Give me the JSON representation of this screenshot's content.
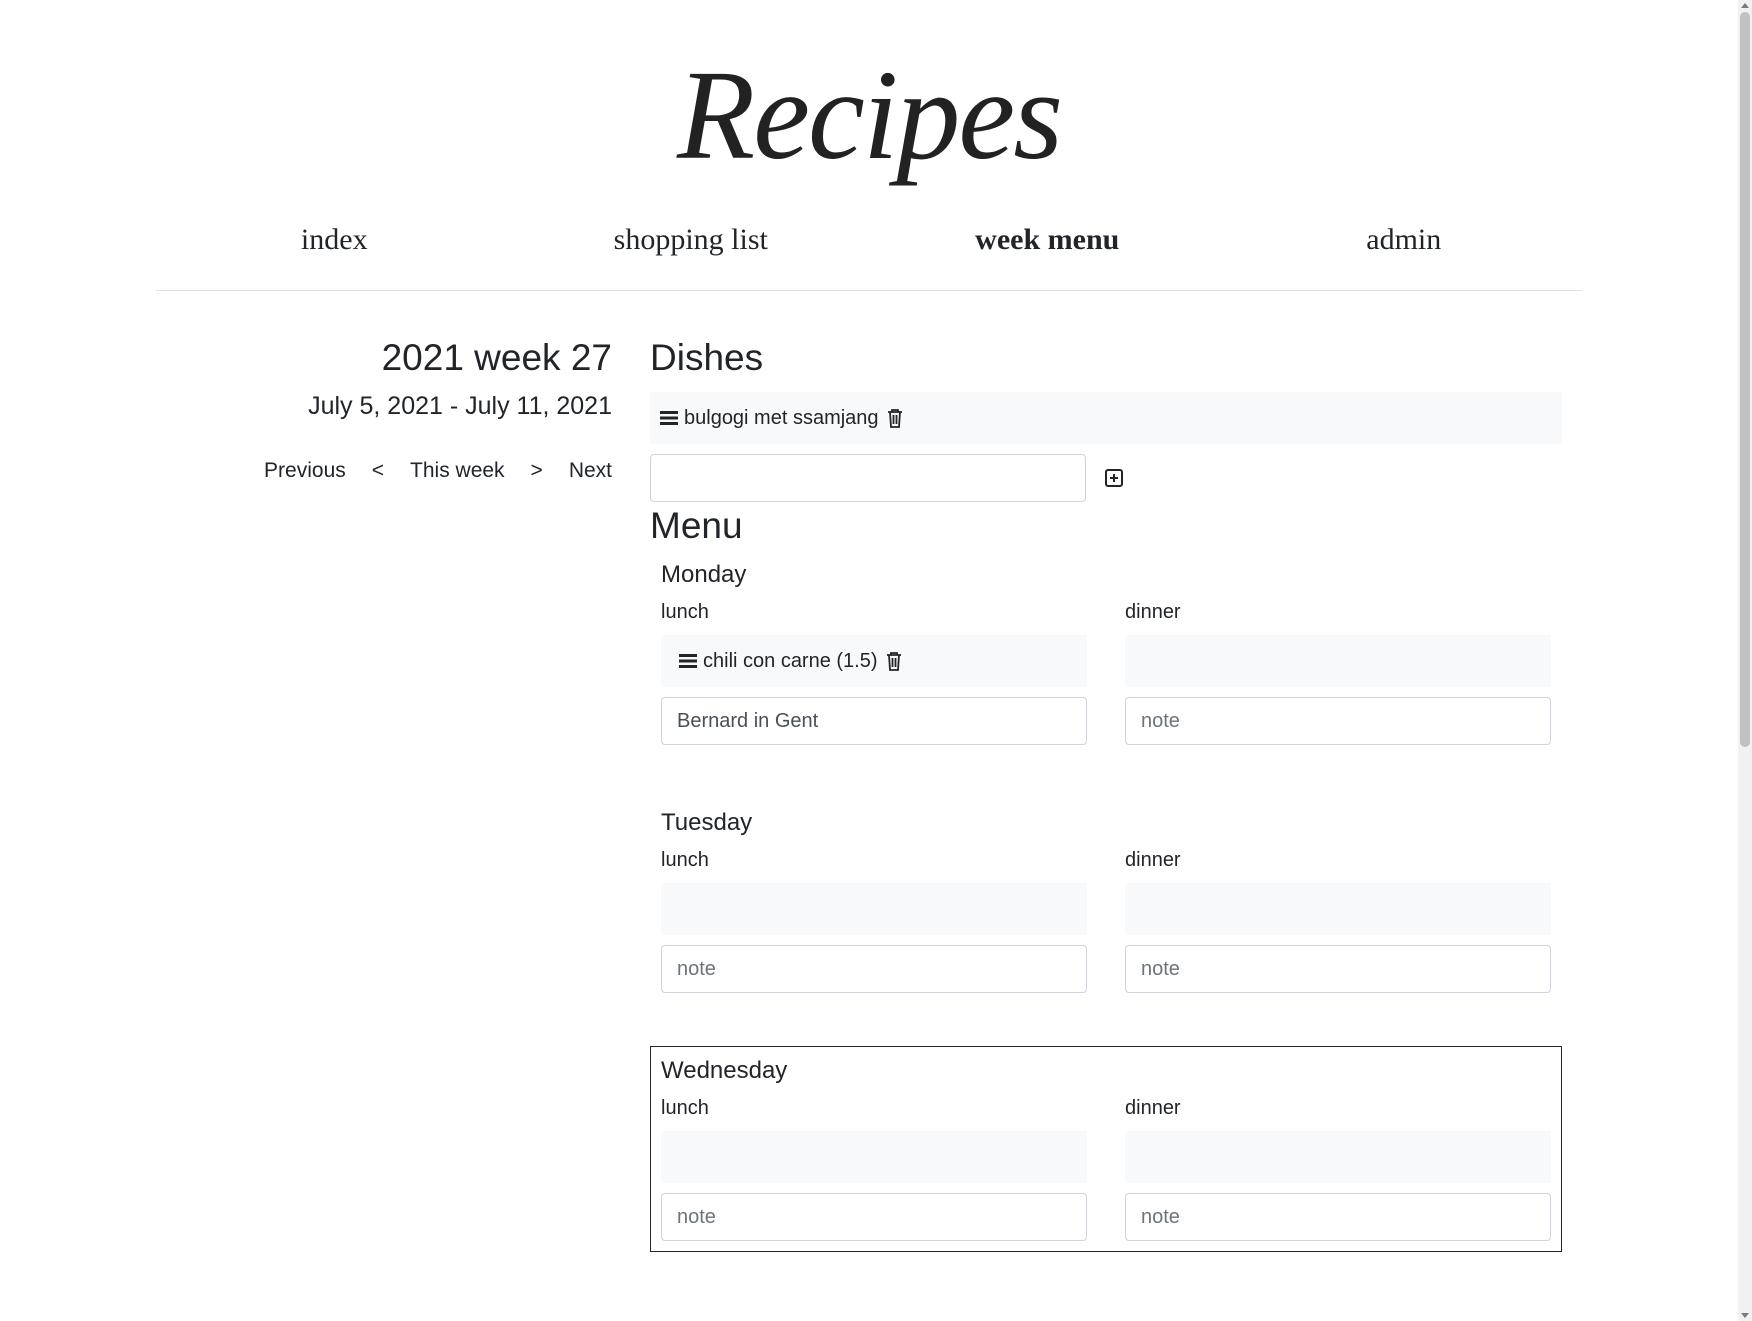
{
  "brand": {
    "title": "Recipes"
  },
  "nav": {
    "items": [
      {
        "label": "index"
      },
      {
        "label": "shopping list"
      },
      {
        "label": "week menu",
        "active": true
      },
      {
        "label": "admin"
      }
    ]
  },
  "week": {
    "title": "2021 week 27",
    "range": "July 5, 2021 - July 11, 2021",
    "previous_label": "Previous",
    "prev_arrow": "<",
    "this_week_label": "This week",
    "next_arrow": ">",
    "next_label": "Next"
  },
  "dishes": {
    "heading": "Dishes",
    "items": [
      {
        "label": "bulgogi met ssamjang"
      }
    ],
    "new_dish_value": ""
  },
  "menu": {
    "heading": "Menu",
    "days": [
      {
        "name": "Monday",
        "lunch_label": "lunch",
        "dinner_label": "dinner",
        "lunch_dish": "chili con carne (1.5)",
        "lunch_note": "Bernard in Gent",
        "dinner_note": "",
        "note_placeholder": "note"
      },
      {
        "name": "Tuesday",
        "lunch_label": "lunch",
        "dinner_label": "dinner",
        "lunch_note": "",
        "dinner_note": "",
        "note_placeholder": "note"
      },
      {
        "name": "Wednesday",
        "current": true,
        "lunch_label": "lunch",
        "dinner_label": "dinner",
        "lunch_note": "",
        "dinner_note": "",
        "note_placeholder": "note"
      }
    ]
  },
  "icons": {
    "drag": "bars-icon",
    "delete": "trash-icon",
    "add": "plus-square-icon"
  }
}
